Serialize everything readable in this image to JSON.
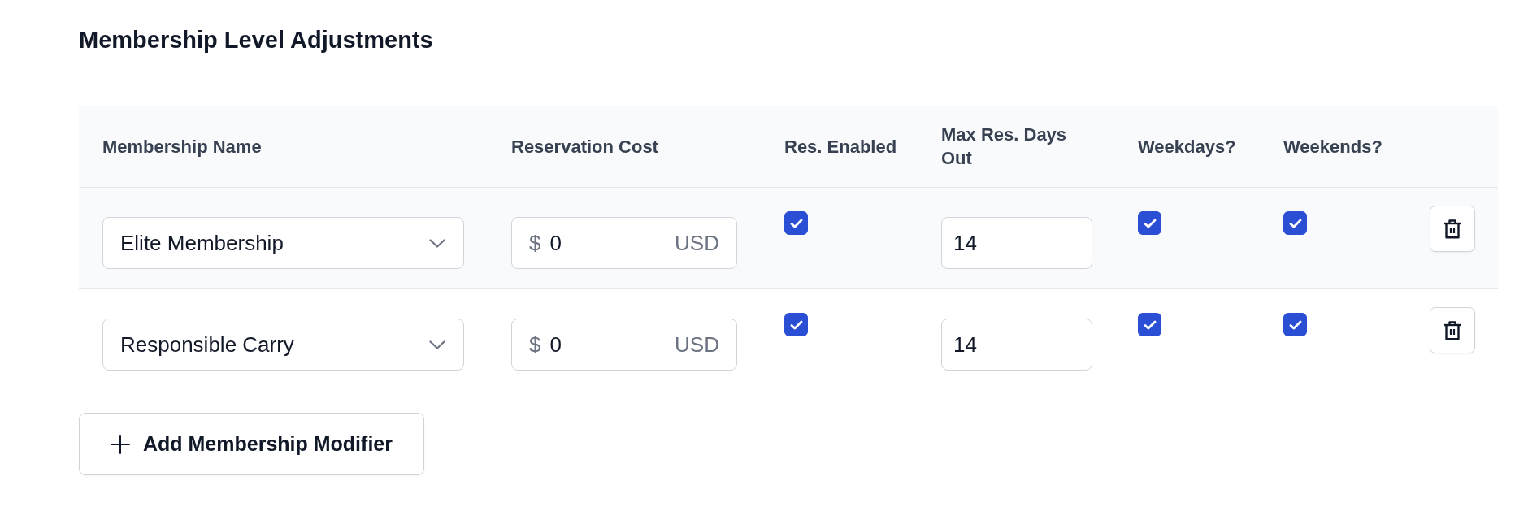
{
  "title": "Membership Level Adjustments",
  "table": {
    "columns": [
      "Membership Name",
      "Reservation Cost",
      "Res. Enabled",
      "Max Res. Days Out",
      "Weekdays?",
      "Weekends?"
    ],
    "rows": [
      {
        "membership": "Elite Membership",
        "cost_prefix": "$",
        "cost": "0",
        "cost_suffix": "USD",
        "res_enabled": true,
        "max_days": "14",
        "weekdays": true,
        "weekends": true
      },
      {
        "membership": "Responsible Carry",
        "cost_prefix": "$",
        "cost": "0",
        "cost_suffix": "USD",
        "res_enabled": true,
        "max_days": "14",
        "weekdays": true,
        "weekends": true
      }
    ]
  },
  "add_button": {
    "label": "Add Membership Modifier"
  }
}
